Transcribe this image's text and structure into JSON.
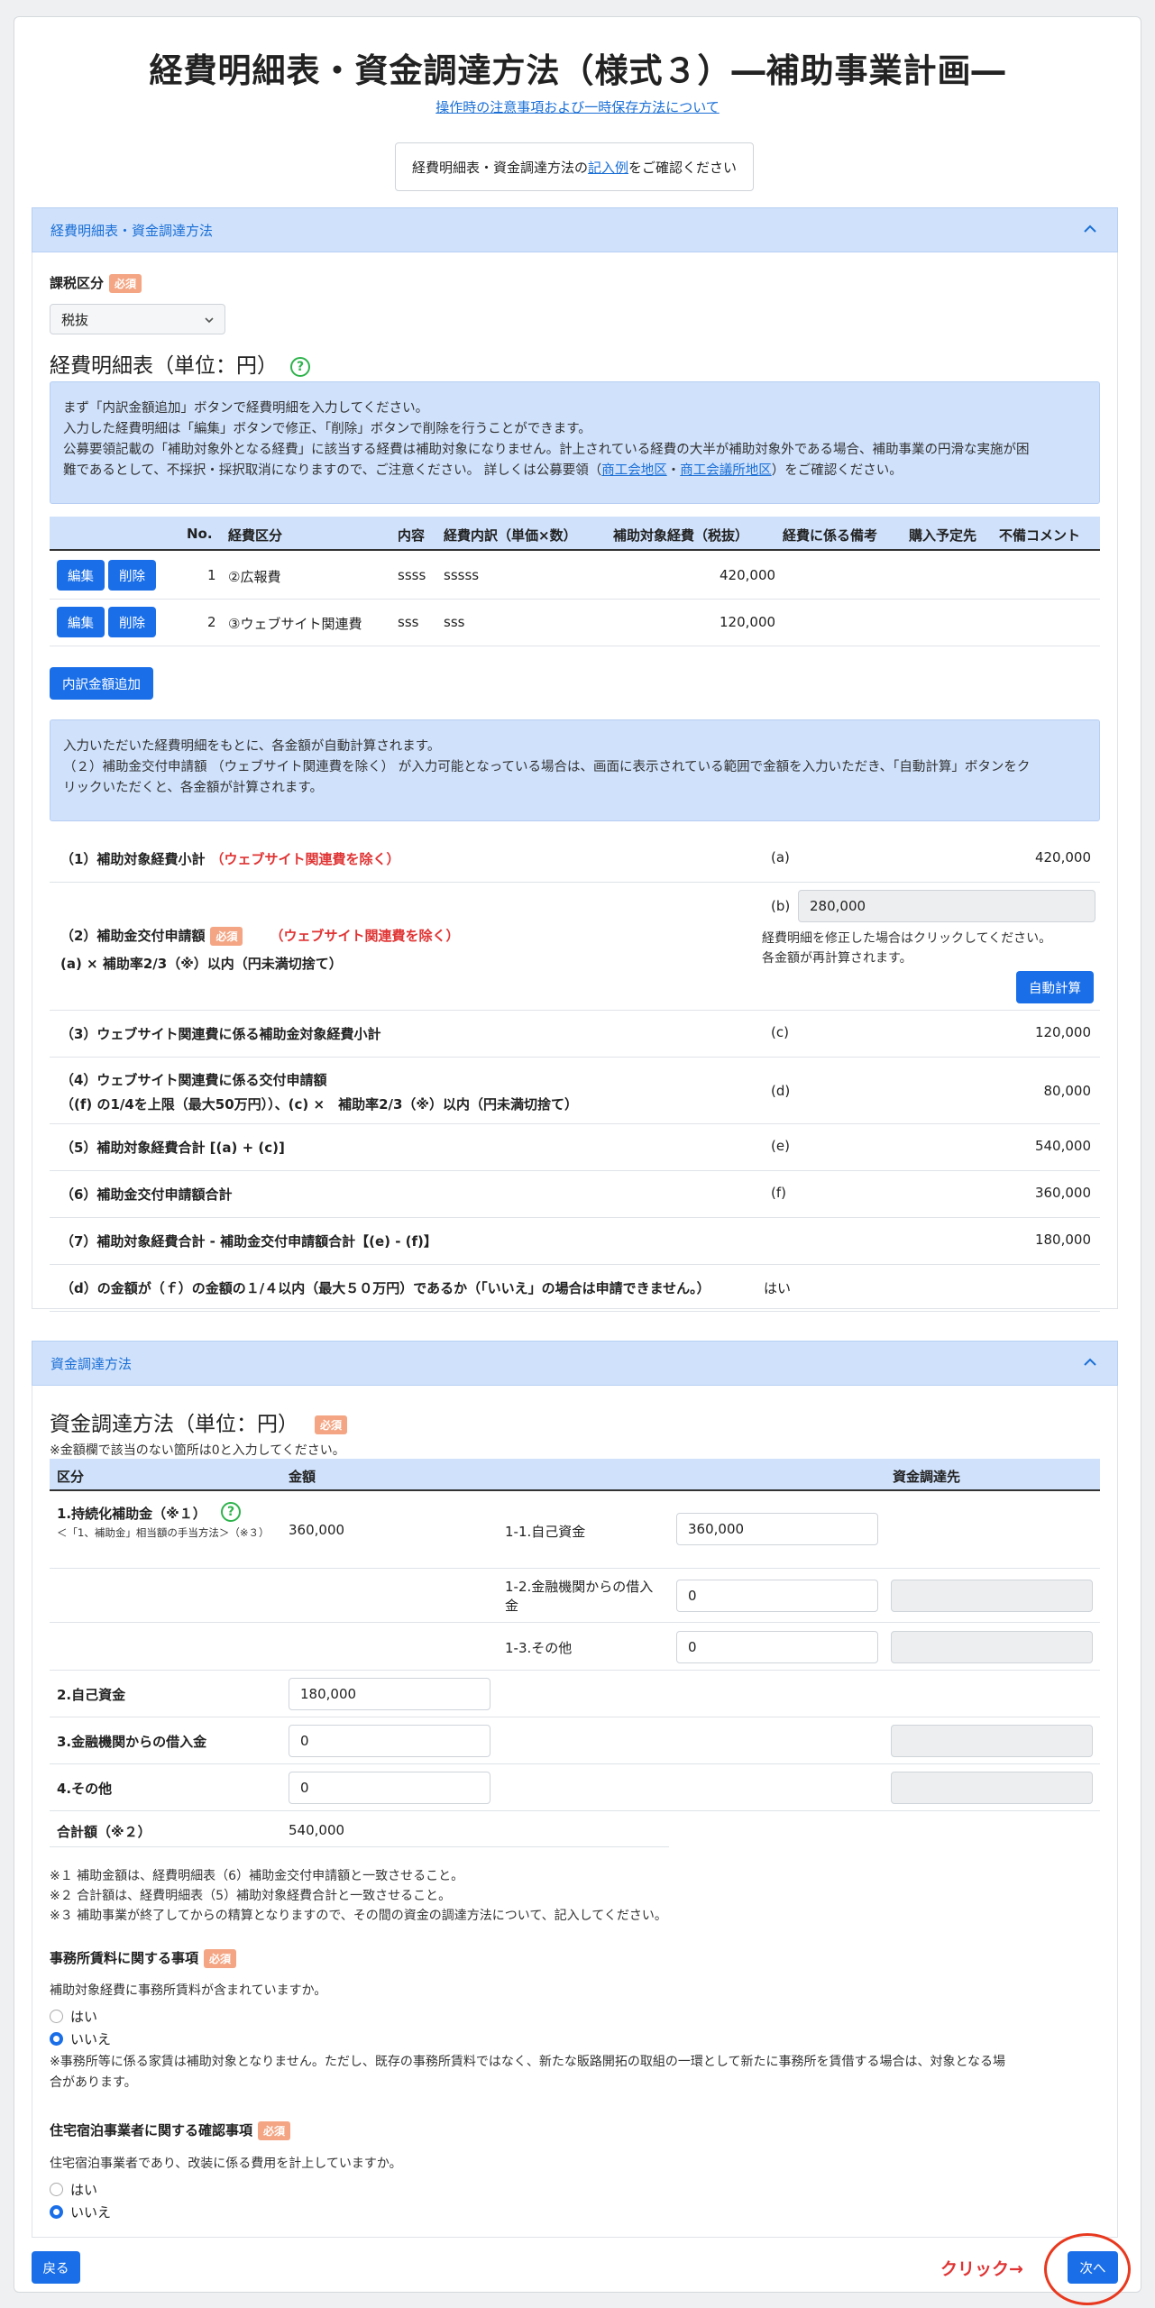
{
  "page": {
    "title": "経費明細表・資金調達方法（様式３）―補助事業計画―",
    "sublink": "操作時の注意事項および一時保存方法について",
    "notebox_pre": "経費明細表・資金調達方法の",
    "notebox_link": "記入例",
    "notebox_post": "をご確認ください"
  },
  "section1": {
    "header": "経費明細表・資金調達方法",
    "tax_label": "課税区分",
    "required": "必須",
    "tax_value": "税抜",
    "table_title": "経費明細表（単位：円）",
    "help": "?",
    "info_lines": [
      "まず「内訳金額追加」ボタンで経費明細を入力してください。",
      "入力した経費明細は「編集」ボタンで修正、「削除」ボタンで削除を行うことができます。",
      "公募要領記載の「補助対象外となる経費」に該当する経費は補助対象になりません。計上されている経費の大半が補助対象外である場合、補助事業の円滑な実施が困",
      "難であるとして、不採択・採択取消になりますので、ご注意ください。 詳しくは公募要領（"
    ],
    "info_link1": "商工会地区",
    "info_sep": "・",
    "info_link2": "商工会議所地区",
    "info_end": "）をご確認ください。",
    "columns": [
      "No.",
      "経費区分",
      "内容",
      "経費内訳（単価×数）",
      "補助対象経費（税抜）",
      "経費に係る備考",
      "購入予定先",
      "不備コメント"
    ],
    "rows": [
      {
        "no": "1",
        "category": "②広報費",
        "content": "ssss",
        "breakdown": "sssss",
        "amount": "420,000"
      },
      {
        "no": "2",
        "category": "③ウェブサイト関連費",
        "content": "sss",
        "breakdown": "sss",
        "amount": "120,000"
      }
    ],
    "edit_label": "編集",
    "delete_label": "削除",
    "add_label": "内訳金額追加",
    "info2_lines": [
      "入力いただいた経費明細をもとに、各金額が自動計算されます。",
      "（２）補助金交付申請額 （ウェブサイト関連費を除く） が入力可能となっている場合は、画面に表示されている範囲で金額を入力いただき、「自動計算」ボタンをク",
      "リックいただくと、各金額が計算されます。"
    ],
    "calc": {
      "r1_label": "（1）補助対象経費小計",
      "r1_note": "（ウェブサイト関連費を除く）",
      "r1_code": "(a)",
      "r1_val": "420,000",
      "r2_label": "（2）補助金交付申請額",
      "r2_note": "（ウェブサイト関連費を除く）",
      "r2_sub": "(a) × 補助率2/3（※）以内（円未満切捨て）",
      "r2_code": "(b)",
      "r2_val": "280,000",
      "r2_hint1": "経費明細を修正した場合はクリックしてください。",
      "r2_hint2": "各金額が再計算されます。",
      "auto_label": "自動計算",
      "r3_label": "（3）ウェブサイト関連費に係る補助金対象経費小計",
      "r3_code": "(c)",
      "r3_val": "120,000",
      "r4_label": "（4）ウェブサイト関連費に係る交付申請額",
      "r4_sub": "（(f) の1/4を上限（最大50万円））、(c) ×　補助率2/3（※）以内（円未満切捨て）",
      "r4_code": "(d)",
      "r4_val": "80,000",
      "r5_label": "（5）補助対象経費合計 [(a) + (c)]",
      "r5_code": "(e)",
      "r5_val": "540,000",
      "r6_label": "（6）補助金交付申請額合計",
      "r6_code": "(f)",
      "r6_val": "360,000",
      "r7_label": "（7）補助対象経費合計 - 補助金交付申請額合計【(e) - (f)】",
      "r7_val": "180,000",
      "r8_label": "（d）の金額が（ｆ）の金額の１/４以内（最大５０万円）であるか（「いいえ」の場合は申請できません。）",
      "r8_val": "はい"
    }
  },
  "section2": {
    "header": "資金調達方法",
    "title": "資金調達方法（単位：円）",
    "required": "必須",
    "note": "※金額欄で該当のない箇所は0と入力してください。",
    "col_kubun": "区分",
    "col_amount": "金額",
    "col_source": "資金調達先",
    "r1_label": "1.持続化補助金（※１）",
    "r1_sub": "＜「1、補助金」相当額の手当方法＞（※３）",
    "r1_amount": "360,000",
    "r1_1_label": "1-1.自己資金",
    "r1_1_val": "360,000",
    "r1_2_label_a": "1-2.金融機関からの借入",
    "r1_2_label_b": "金",
    "r1_2_val": "0",
    "r1_3_label": "1-3.その他",
    "r1_3_val": "0",
    "r2_label": "2.自己資金",
    "r2_val": "180,000",
    "r3_label": "3.金融機関からの借入金",
    "r3_val": "0",
    "r4_label": "4.その他",
    "r4_val": "0",
    "total_label": "合計額（※２）",
    "total_val": "540,000",
    "footnotes": [
      "※１ 補助金額は、経費明細表（6）補助金交付申請額と一致させること。",
      "※２ 合計額は、経費明細表（5）補助対象経費合計と一致させること。",
      "※３ 補助事業が終了してからの精算となりますので、その間の資金の調達方法について、記入してください。"
    ],
    "office_title": "事務所賃料に関する事項",
    "office_q": "補助対象経費に事務所賃料が含まれていますか。",
    "yes": "はい",
    "no": "いいえ",
    "office_note1": "※事務所等に係る家賃は補助対象となりません。ただし、既存の事務所賃料ではなく、新たな販路開拓の取組の一環として新たに事務所を賃借する場合は、対象となる場",
    "office_note2": "合があります。",
    "lodging_title": "住宅宿泊事業者に関する確認事項",
    "lodging_q": "住宅宿泊事業者であり、改装に係る費用を計上していますか。"
  },
  "footer": {
    "back": "戻る",
    "next": "次へ",
    "annotation": "クリック→"
  }
}
